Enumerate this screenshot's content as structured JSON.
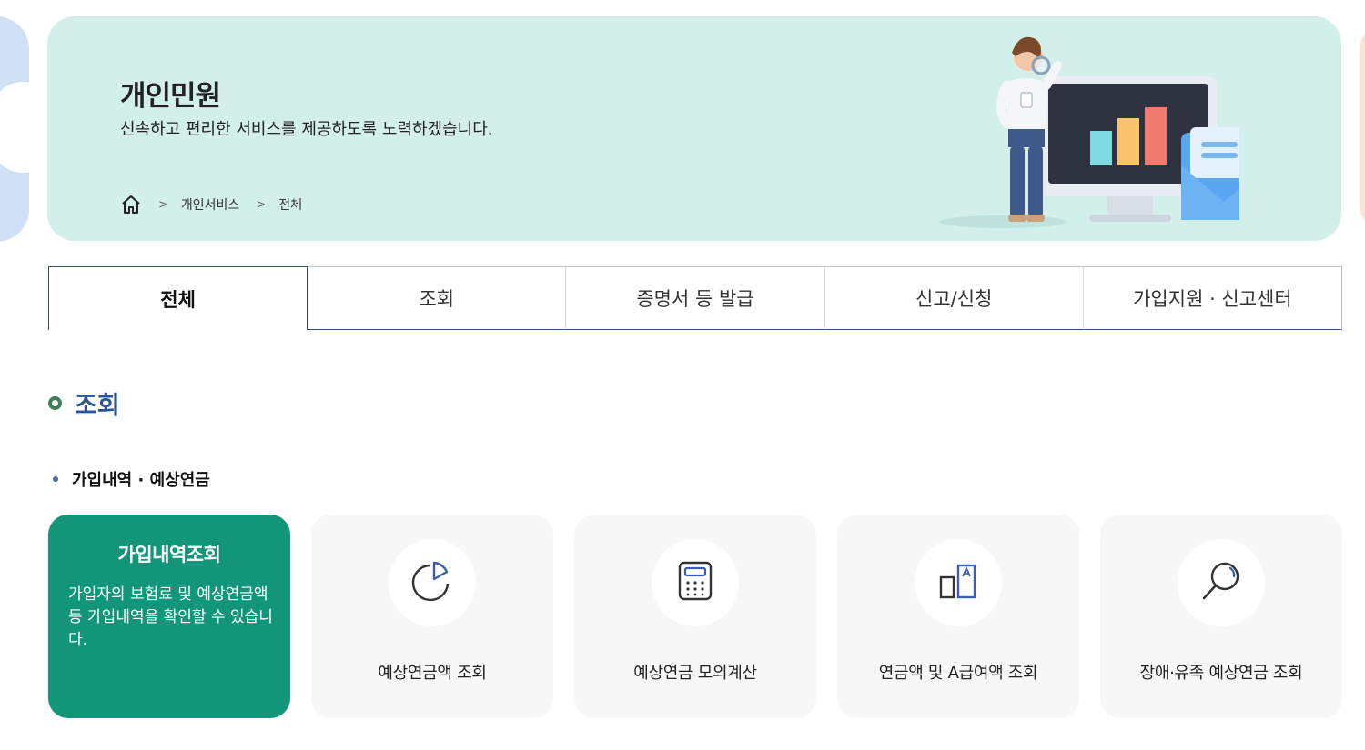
{
  "hero": {
    "title": "개인민원",
    "subtitle": "신속하고 편리한 서비스를 제공하도록 노력하겠습니다.",
    "breadcrumb": [
      "개인서비스",
      "전체"
    ],
    "illustration": "woman-with-magnifier-monitor-chart-envelope"
  },
  "tabs": [
    {
      "label": "전체",
      "active": true
    },
    {
      "label": "조회",
      "active": false
    },
    {
      "label": "증명서 등 발급",
      "active": false
    },
    {
      "label": "신고/신청",
      "active": false
    },
    {
      "label": "가입지원 · 신고센터",
      "active": false
    }
  ],
  "section": {
    "title": "조회",
    "subsection": "가입내역 · 예상연금"
  },
  "cards": [
    {
      "title": "가입내역조회",
      "description": "가입자의 보험료 및 예상연금액 등 가입내역을 확인할 수 있습니다.",
      "highlighted": true
    },
    {
      "label": "예상연금액 조회",
      "icon": "pie-chart-icon"
    },
    {
      "label": "예상연금 모의계산",
      "icon": "calculator-icon"
    },
    {
      "label": "연금액 및 A급여액 조회",
      "icon": "bar-compare-icon"
    },
    {
      "label": "장애·유족 예상연금 조회",
      "icon": "magnifier-icon"
    }
  ],
  "colors": {
    "hero_bg": "#d3efea",
    "accent_green": "#13957a",
    "section_blue": "#2f5597",
    "tab_border": "#2e4b7a"
  }
}
